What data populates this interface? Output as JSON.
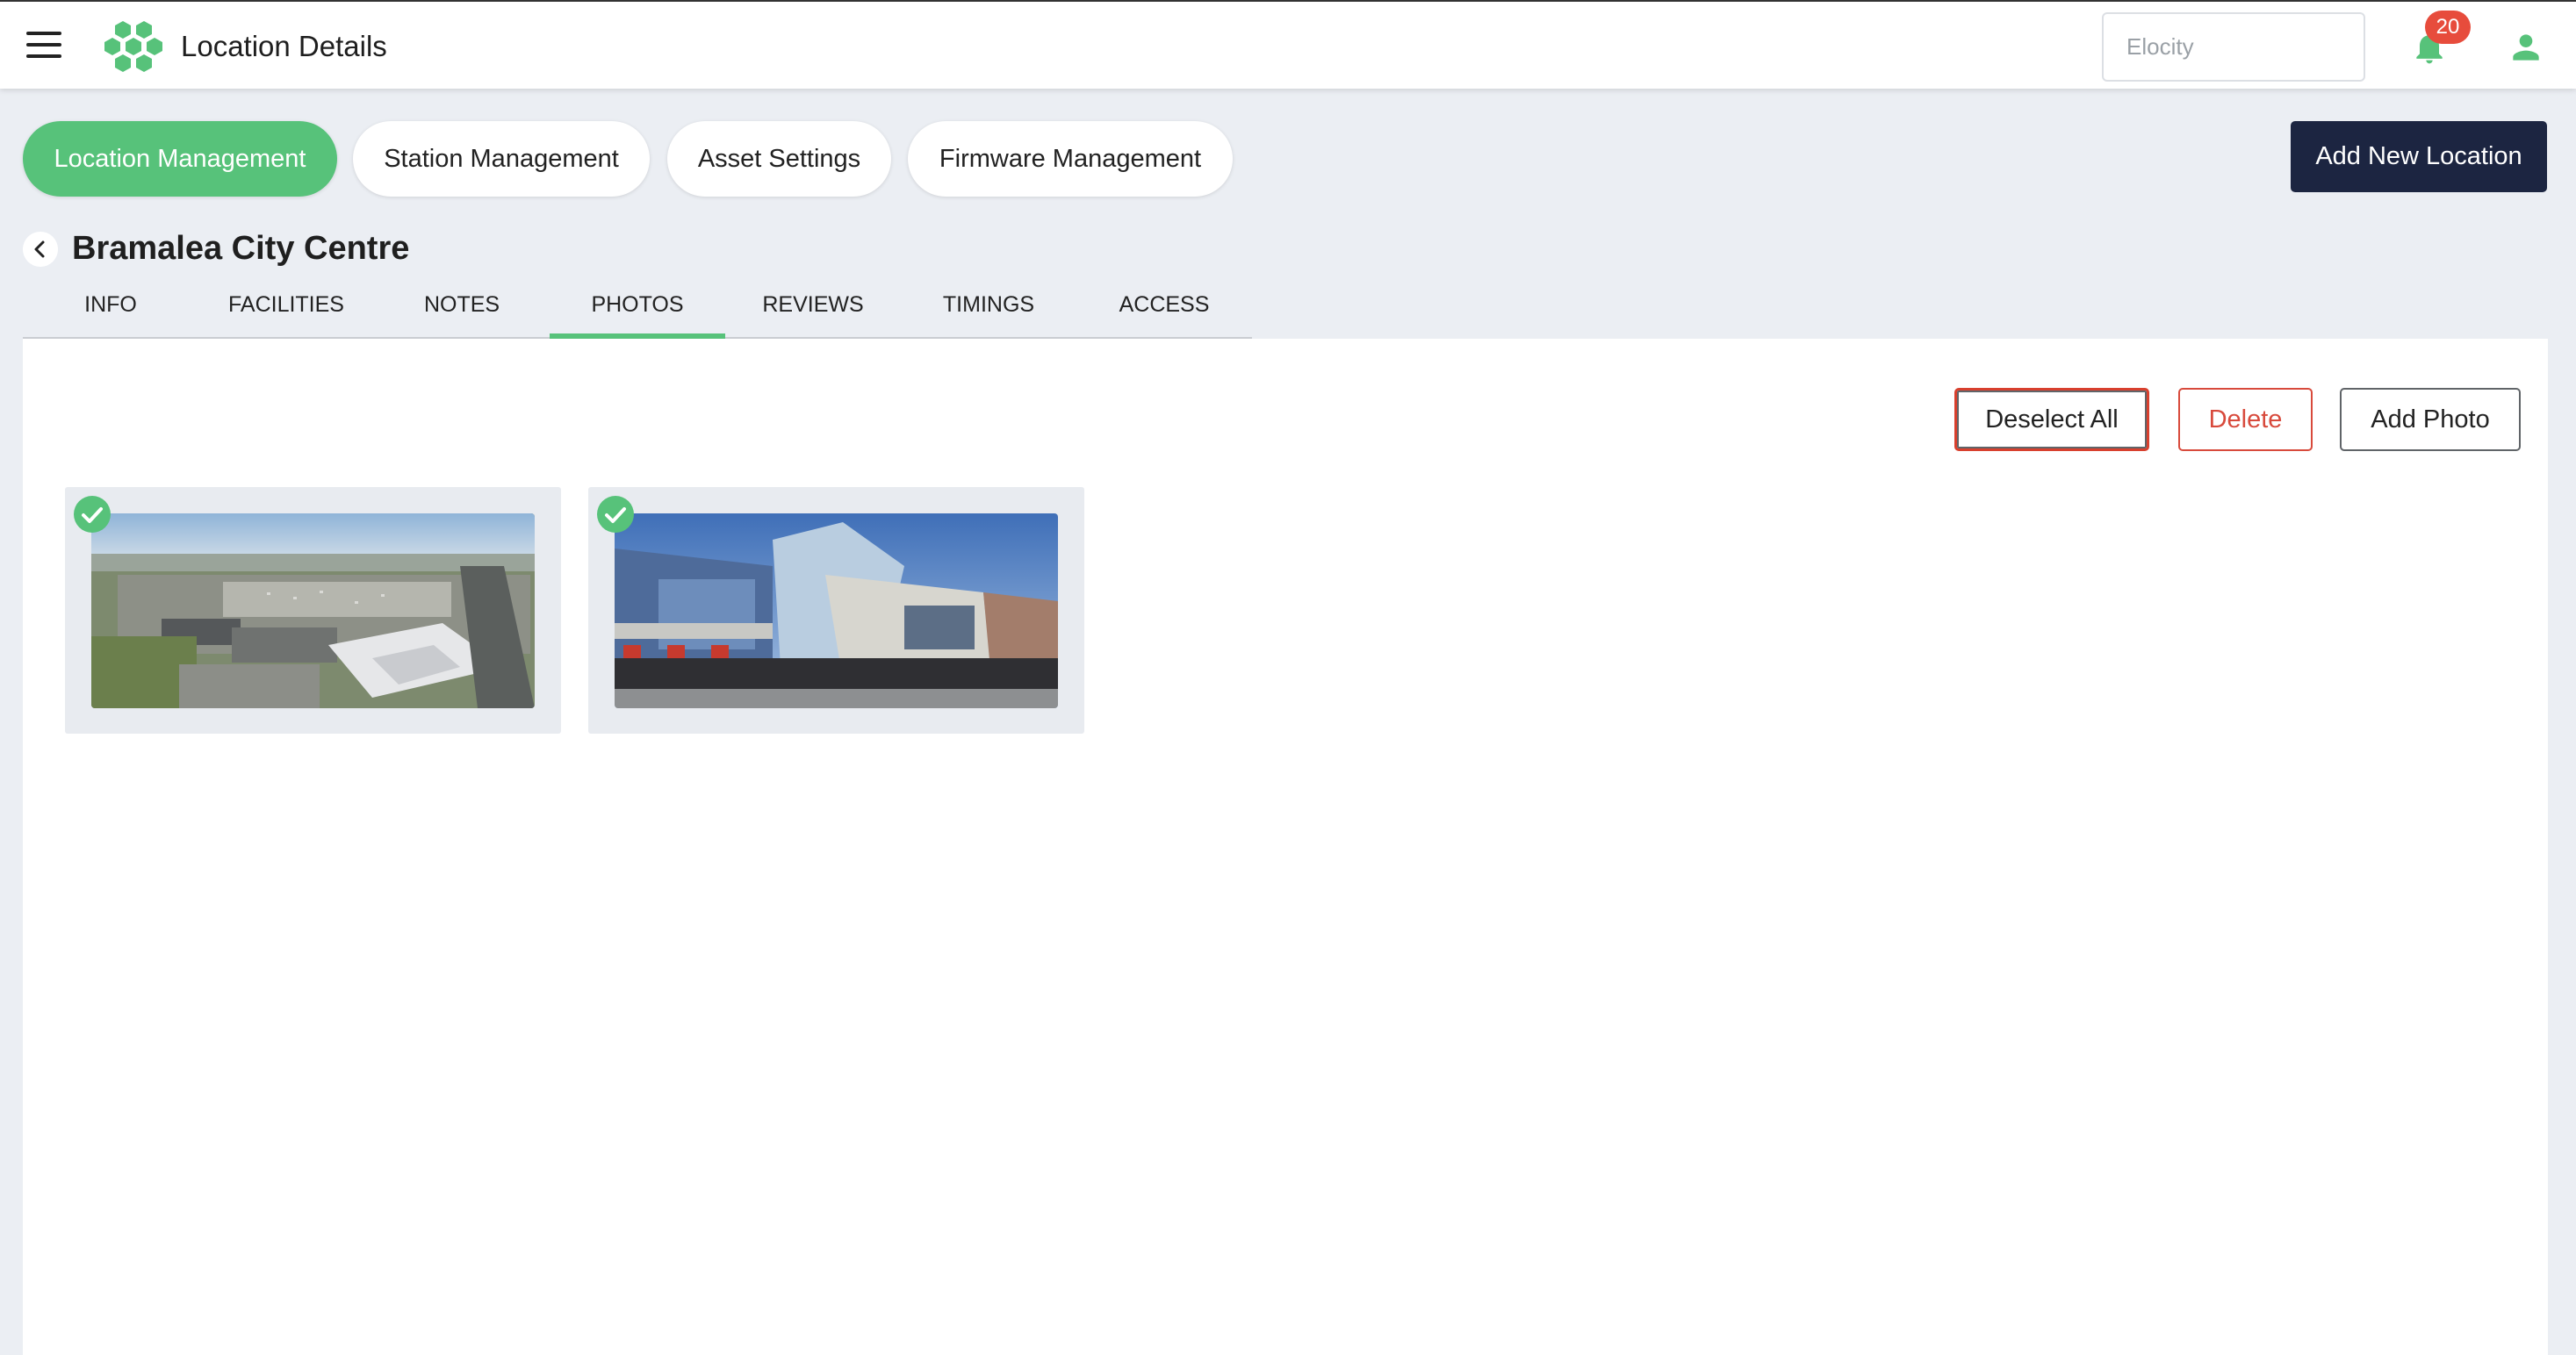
{
  "header": {
    "title": "Location Details",
    "search_placeholder": "Elocity",
    "notification_count": "20",
    "icons": [
      "menu-icon",
      "hexagon-logo-icon",
      "bell-icon",
      "user-icon"
    ]
  },
  "nav_tabs": [
    {
      "label": "Location Management",
      "active": true
    },
    {
      "label": "Station Management",
      "active": false
    },
    {
      "label": "Asset Settings",
      "active": false
    },
    {
      "label": "Firmware Management",
      "active": false
    }
  ],
  "add_location_label": "Add New Location",
  "location_name": "Bramalea City Centre",
  "detail_tabs": [
    {
      "label": "INFO",
      "active": false
    },
    {
      "label": "FACILITIES",
      "active": false
    },
    {
      "label": "NOTES",
      "active": false
    },
    {
      "label": "PHOTOS",
      "active": true
    },
    {
      "label": "REVIEWS",
      "active": false
    },
    {
      "label": "TIMINGS",
      "active": false
    },
    {
      "label": "ACCESS",
      "active": false
    }
  ],
  "photo_actions": {
    "deselect_all": "Deselect All",
    "delete": "Delete",
    "add_photo": "Add Photo"
  },
  "photos": [
    {
      "subject": "aerial view of mall parking",
      "selected": true
    },
    {
      "subject": "mall entrance facade",
      "selected": true
    }
  ],
  "colors": {
    "accent_green": "#57c27a",
    "dark_navy": "#1c2541",
    "danger_red": "#d84a3c",
    "badge_red": "#e74c3c"
  }
}
